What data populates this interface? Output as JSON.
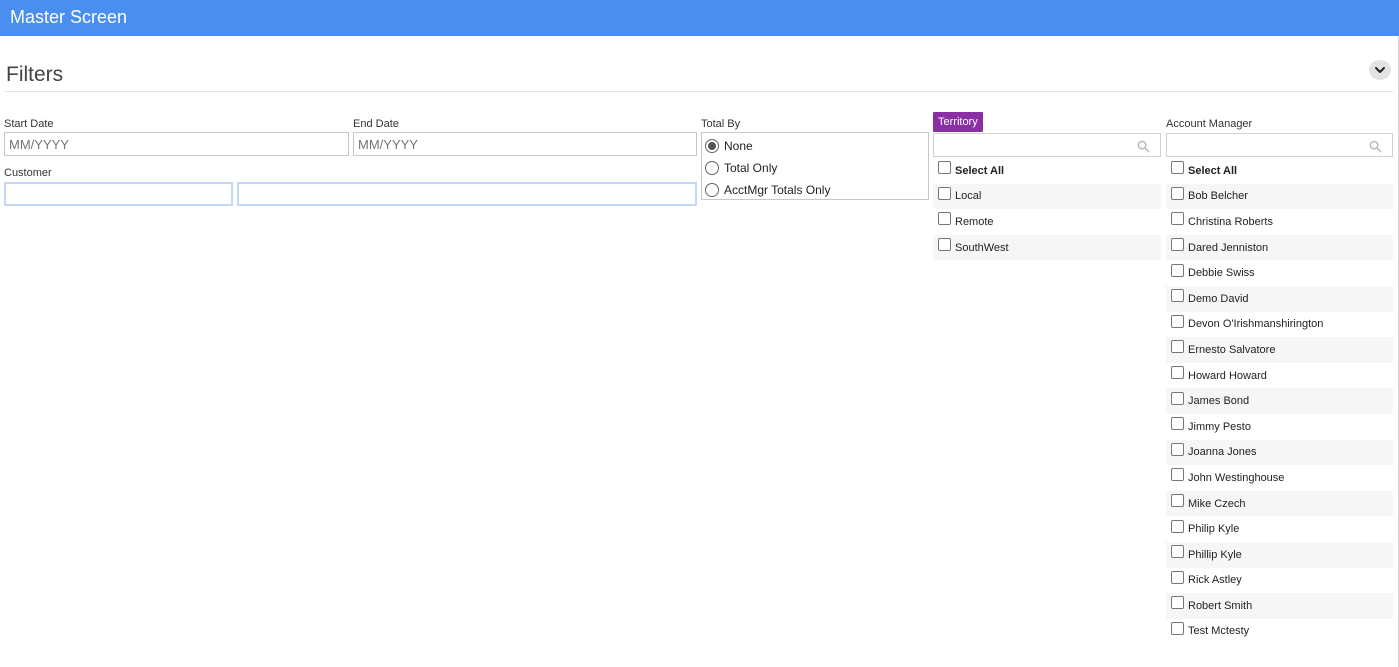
{
  "app": {
    "title": "Master Screen"
  },
  "filters": {
    "heading": "Filters",
    "start_date": {
      "label": "Start Date",
      "placeholder": "MM/YYYY"
    },
    "end_date": {
      "label": "End Date",
      "placeholder": "MM/YYYY"
    },
    "customer": {
      "label": "Customer",
      "code_value": "",
      "name_value": ""
    },
    "total_by": {
      "label": "Total By",
      "options": [
        {
          "label": "None",
          "selected": true
        },
        {
          "label": "Total Only",
          "selected": false
        },
        {
          "label": "AcctMgr Totals Only",
          "selected": false
        }
      ]
    },
    "territory": {
      "label": "Territory",
      "search_value": "",
      "select_all": "Select All",
      "items": [
        "Local",
        "Remote",
        "SouthWest"
      ]
    },
    "account_manager": {
      "label": "Account Manager",
      "search_value": "",
      "select_all": "Select All",
      "items": [
        "Bob Belcher",
        "Christina Roberts",
        "Dared Jenniston",
        "Debbie Swiss",
        "Demo David",
        "Devon O'Irishmanshirington",
        "Ernesto Salvatore",
        "Howard Howard",
        "James Bond",
        "Jimmy Pesto",
        "Joanna Jones",
        "John Westinghouse",
        "Mike Czech",
        "Philip Kyle",
        "Phillip Kyle",
        "Rick Astley",
        "Robert Smith",
        "Test Mctesty"
      ]
    }
  },
  "colors": {
    "header": "#4a8ef0",
    "territory_badge": "#8a2fa3"
  },
  "icons": {
    "collapse": "chevron-down-icon",
    "search": "search-icon"
  }
}
